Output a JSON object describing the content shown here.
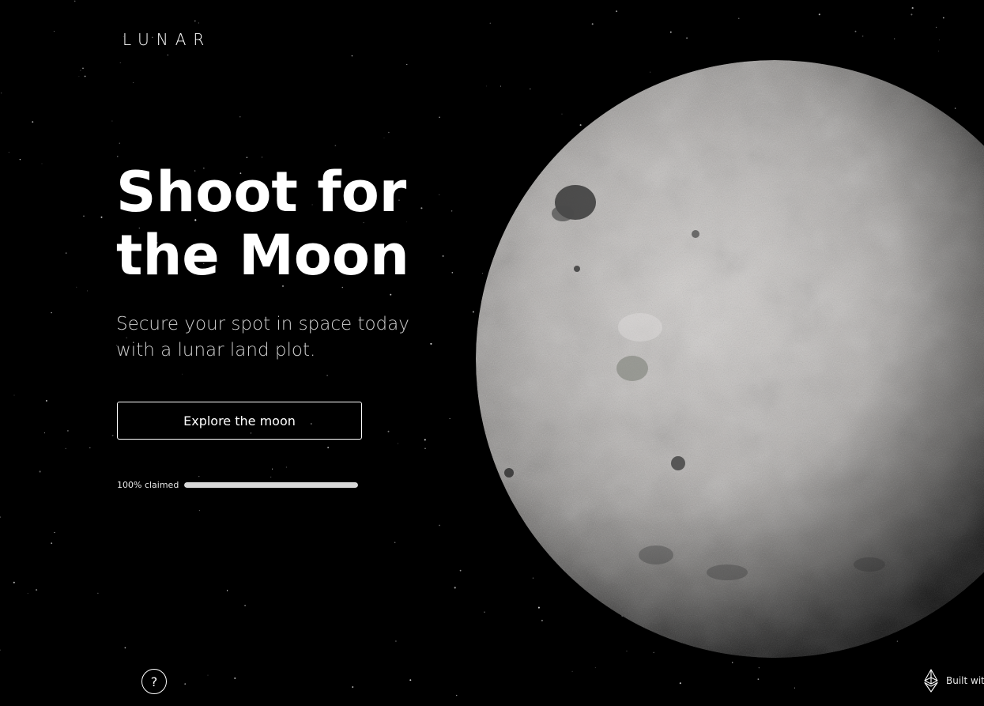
{
  "brand": {
    "logo": "LUNAR"
  },
  "hero": {
    "headline_line1": "Shoot for",
    "headline_line2": "the Moon",
    "subtitle_line1": "Secure your spot in space today",
    "subtitle_line2": "with a lunar land plot.",
    "cta_label": "Explore the moon"
  },
  "progress": {
    "label": "100% claimed",
    "percent": 100,
    "fill_color": "#d8d8d8"
  },
  "help": {
    "icon": "question-icon",
    "label": "?"
  },
  "footer": {
    "built_with_icon": "ethereum-icon",
    "built_with_text": "Built with"
  },
  "colors": {
    "background": "#000000",
    "text": "#ffffff",
    "subtitle": "#cfcfcf",
    "moon_light": "#c9c6c4",
    "moon_dark": "#2a2a2a"
  }
}
